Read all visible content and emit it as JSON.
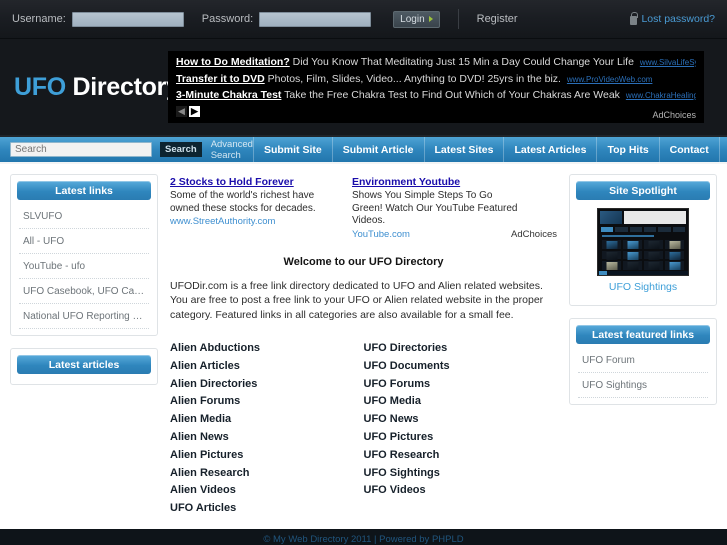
{
  "topbar": {
    "username_label": "Username:",
    "username_value": "",
    "username_placeholder": "",
    "password_label": "Password:",
    "password_value": "",
    "password_placeholder": "",
    "login_label": "Login",
    "register_label": "Register",
    "lost_password_label": "Lost password?"
  },
  "header": {
    "logo_primary": "UFO",
    "logo_secondary": "Directory",
    "adchoices_label": "AdChoices",
    "ad_prev": "◀",
    "ad_next": "▶",
    "ads": [
      {
        "title": "How to Do Meditation?",
        "body": "Did You Know That Meditating Just 15 Min a Day Could Change Your Life",
        "url": "www.SilvaLifeSystem.com"
      },
      {
        "title": "Transfer it to DVD",
        "body": "Photos, Film, Slides, Video... Anything to DVD! 25yrs in the biz.",
        "url": "www.ProVideoWeb.com"
      },
      {
        "title": "3-Minute Chakra Test",
        "body": "Take the Free Chakra Test to Find Out Which of Your Chakras Are Weak",
        "url": "www.ChakraHealing.com"
      }
    ]
  },
  "nav": {
    "search_placeholder": "Search",
    "search_value": "",
    "search_button": "Search",
    "advanced_search": "Advanced Search",
    "items": [
      {
        "label": "Submit Site"
      },
      {
        "label": "Submit Article"
      },
      {
        "label": "Latest Sites"
      },
      {
        "label": "Latest Articles"
      },
      {
        "label": "Top Hits"
      },
      {
        "label": "Contact"
      }
    ],
    "rss_icon": "rss-icon"
  },
  "sidebar_left": {
    "latest_links": {
      "title": "Latest links",
      "items": [
        {
          "label": "SLVUFO"
        },
        {
          "label": "All - UFO"
        },
        {
          "label": "YouTube - ufo"
        },
        {
          "label": "UFO Casebook, UFO Case file..."
        },
        {
          "label": "National UFO Reporting Center"
        }
      ]
    },
    "latest_articles": {
      "title": "Latest articles",
      "items": []
    }
  },
  "sidebar_right": {
    "spotlight": {
      "title": "Site Spotlight",
      "link_label": "UFO Sightings",
      "thumbnail_icon": "website-thumbnail"
    },
    "featured": {
      "title": "Latest featured links",
      "items": [
        {
          "label": "UFO Forum"
        },
        {
          "label": "UFO Sightings"
        }
      ]
    }
  },
  "main": {
    "adchoices_label": "AdChoices",
    "ads": [
      {
        "title": "2 Stocks to Hold Forever",
        "body": "Some of the world's richest have owned these stocks for decades.",
        "url": "www.StreetAuthority.com"
      },
      {
        "title": "Environment Youtube",
        "body": "Shows You Simple Steps To Go Green! Watch Our YouTube Featured Videos.",
        "url": "YouTube.com"
      }
    ],
    "welcome_title": "Welcome to our UFO Directory",
    "welcome_text": "UFODir.com is a free link directory dedicated to UFO and Alien related websites. You are free to post a free link to your UFO or Alien related website in the proper category. Featured links in all categories are also available for a small fee.",
    "categories_col1": [
      {
        "label": "Alien Abductions"
      },
      {
        "label": "Alien Articles"
      },
      {
        "label": "Alien Directories"
      },
      {
        "label": "Alien Forums"
      },
      {
        "label": "Alien Media"
      },
      {
        "label": "Alien News"
      },
      {
        "label": "Alien Pictures"
      },
      {
        "label": "Alien Research"
      },
      {
        "label": "Alien Videos"
      },
      {
        "label": "UFO Articles"
      }
    ],
    "categories_col2": [
      {
        "label": "UFO Directories"
      },
      {
        "label": "UFO Documents"
      },
      {
        "label": "UFO Forums"
      },
      {
        "label": "UFO Media"
      },
      {
        "label": "UFO News"
      },
      {
        "label": "UFO Pictures"
      },
      {
        "label": "UFO Research"
      },
      {
        "label": "UFO Sightings"
      },
      {
        "label": "UFO Videos"
      }
    ]
  },
  "footer": {
    "text": "© My Web Directory 2011 | Powered by PHPLD"
  },
  "colors": {
    "accent_blue": "#2f86bd",
    "logo_blue": "#3e9fd8",
    "link_blue": "#1a0dab",
    "dark_bg": "#0e1419",
    "header_bg": "#15181c"
  }
}
